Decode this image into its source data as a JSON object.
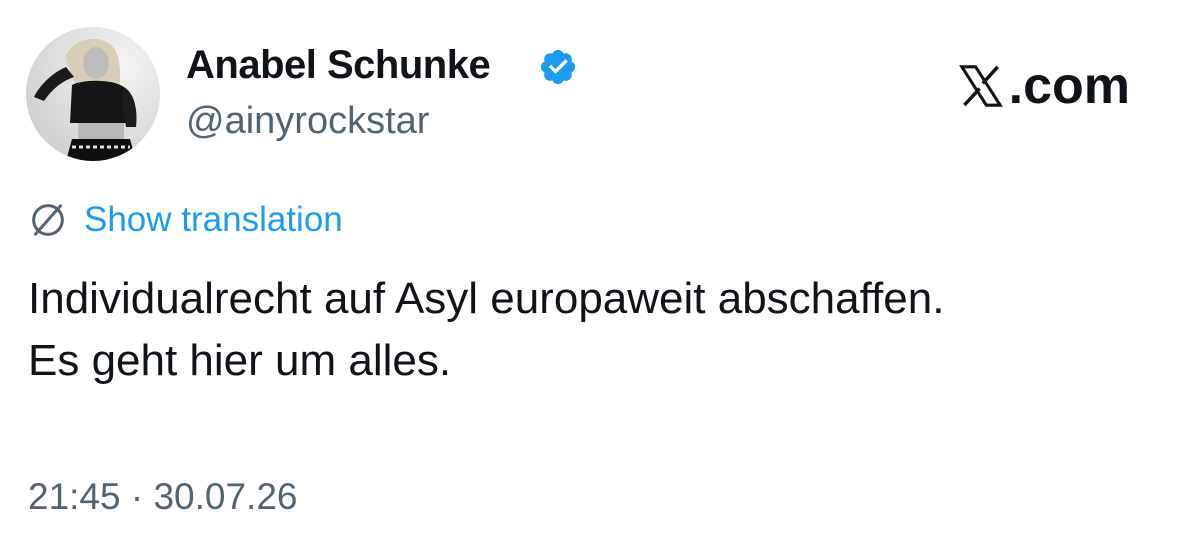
{
  "author": {
    "display_name": "Anabel Schunke",
    "handle": "@ainyrockstar",
    "verified": true,
    "avatar_icon": "profile-photo-avatar",
    "verified_icon": "verified-badge-icon"
  },
  "brand": {
    "label": ".com",
    "icon": "x-logo-icon"
  },
  "translation": {
    "label": "Show translation",
    "icon": "globe-icon"
  },
  "tweet": {
    "lines": [
      "Individualrecht auf Asyl europaweit abschaffen.",
      "Es geht hier um alles."
    ]
  },
  "meta": {
    "timestamp": "21:45 · 30.07.26"
  },
  "colors": {
    "text": "#0f1419",
    "secondary": "#536471",
    "link": "#1d9bf0",
    "verified_badge": "#1d9bf0"
  }
}
